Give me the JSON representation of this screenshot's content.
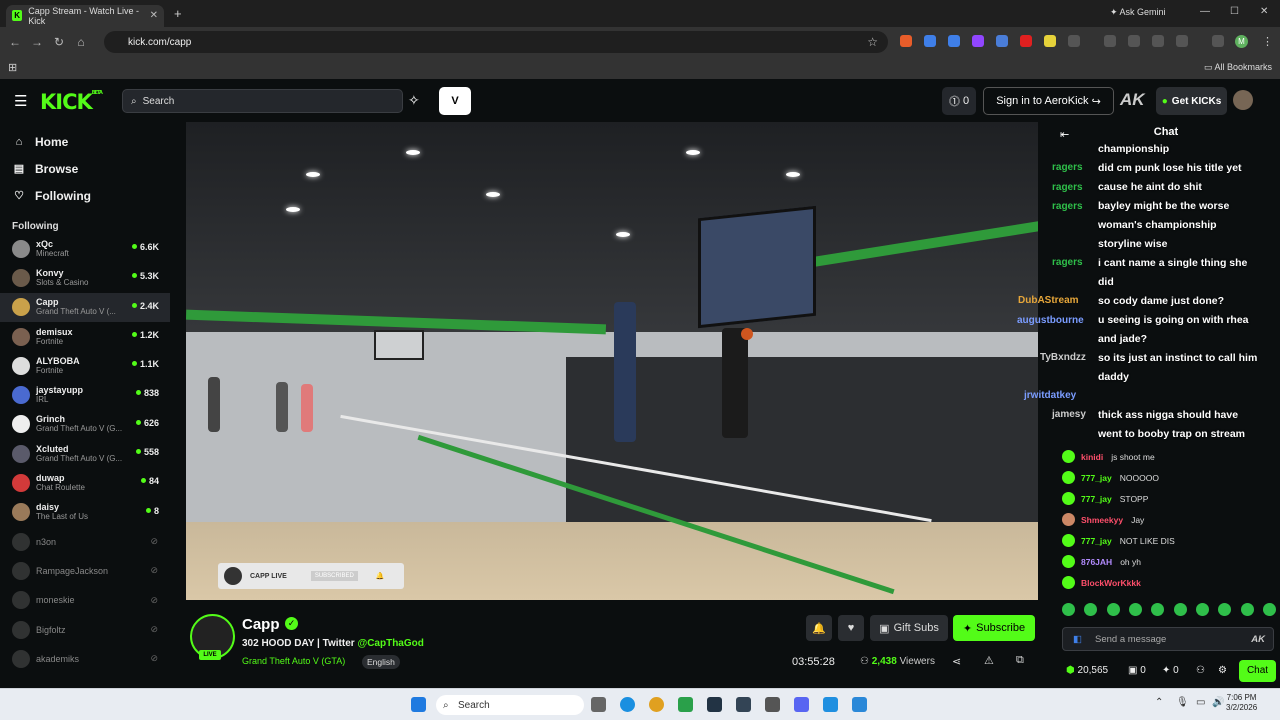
{
  "browser": {
    "tab_title": "Capp Stream - Watch Live - Kick",
    "tab_favicon": "K",
    "new_tab": "+",
    "gemini": "Ask Gemini",
    "url": "kick.com/capp",
    "all_bookmarks": "All Bookmarks",
    "avatar_letter": "M"
  },
  "header": {
    "logo": "KICK",
    "logo_beta": "BETA",
    "search_placeholder": "Search",
    "notif_count": "0",
    "sign_in": "Sign in to AeroKick",
    "get_kicks": "Get KICKs",
    "ak_logo": "AK"
  },
  "sidebar": {
    "nav": [
      {
        "label": "Home",
        "icon": "home-icon"
      },
      {
        "label": "Browse",
        "icon": "browse-icon"
      },
      {
        "label": "Following",
        "icon": "heart-icon"
      }
    ],
    "following_title": "Following",
    "channels": [
      {
        "name": "xQc",
        "game": "Minecraft",
        "viewers": "6.6K"
      },
      {
        "name": "Konvy",
        "game": "Slots & Casino",
        "viewers": "5.3K"
      },
      {
        "name": "Capp",
        "game": "Grand Theft Auto V (...",
        "viewers": "2.4K"
      },
      {
        "name": "demisux",
        "game": "Fortnite",
        "viewers": "1.2K"
      },
      {
        "name": "ALYBOBA",
        "game": "Fortnite",
        "viewers": "1.1K"
      },
      {
        "name": "jaystayupp",
        "game": "IRL",
        "viewers": "838"
      },
      {
        "name": "Grinch",
        "game": "Grand Theft Auto V (G...",
        "viewers": "626"
      },
      {
        "name": "Xcluted",
        "game": "Grand Theft Auto V (G...",
        "viewers": "558"
      },
      {
        "name": "duwap",
        "game": "Chat Roulette",
        "viewers": "84"
      },
      {
        "name": "daisy",
        "game": "The Last of Us",
        "viewers": "8"
      }
    ],
    "offline": [
      "n3on",
      "RampageJackson",
      "moneskie",
      "Bigfoltz",
      "akademiks"
    ]
  },
  "video": {
    "overlay_text": "CAPP LIVE",
    "overlay_sub": "SUBSCRIBED"
  },
  "stream": {
    "channel": "Capp",
    "live_badge": "LIVE",
    "title": "302 HOOD DAY | Twitter ",
    "twitter": "@CapThaGod",
    "category": "Grand Theft Auto V (GTA)",
    "language": "English",
    "gift_subs": "Gift Subs",
    "subscribe": "Subscribe",
    "uptime": "03:55:28",
    "viewers": "2,438",
    "viewers_label": "Viewers"
  },
  "chat": {
    "header": "Chat",
    "overlay_lines": [
      "championship",
      "did cm punk lose his title yet",
      "cause he aint do shit",
      "bayley might be the worse",
      "woman's championship",
      "storyline wise",
      "i cant name a single thing she",
      "did",
      "so cody dame just done?",
      "u seeing is going on with rhea",
      "and jade?",
      "so its just an instinct to call him",
      "daddy",
      "thick ass nigga should have",
      "went to booby trap on stream"
    ],
    "overlay_names": [
      "ragers",
      "ragers",
      "ragers",
      "ragers",
      "DubAStream",
      "augustbourne",
      "TyBxndzz",
      "jrwitdatkey",
      "jamesy"
    ],
    "messages": [
      {
        "user": "kinidi",
        "text": "js shoot me",
        "color": "#ff4f6b"
      },
      {
        "user": "777_jay",
        "text": "NOOOOO",
        "color": "#53fc18"
      },
      {
        "user": "777_jay",
        "text": "STOPP",
        "color": "#53fc18"
      },
      {
        "user": "Shmeekyy",
        "text": "Jay",
        "color": "#ff4f6b"
      },
      {
        "user": "777_jay",
        "text": "NOT LIKE DIS",
        "color": "#53fc18"
      },
      {
        "user": "876JAH",
        "text": "oh yh",
        "color": "#b38cff"
      },
      {
        "user": "BlockWorKkkk",
        "text": "",
        "color": "#ff4f6b"
      }
    ],
    "input_placeholder": "Send a message",
    "points": "20,565",
    "count_a": "0",
    "count_b": "0",
    "chat_button": "Chat"
  },
  "taskbar": {
    "search": "Search",
    "time": "7:06 PM",
    "date": "3/2/2026"
  }
}
